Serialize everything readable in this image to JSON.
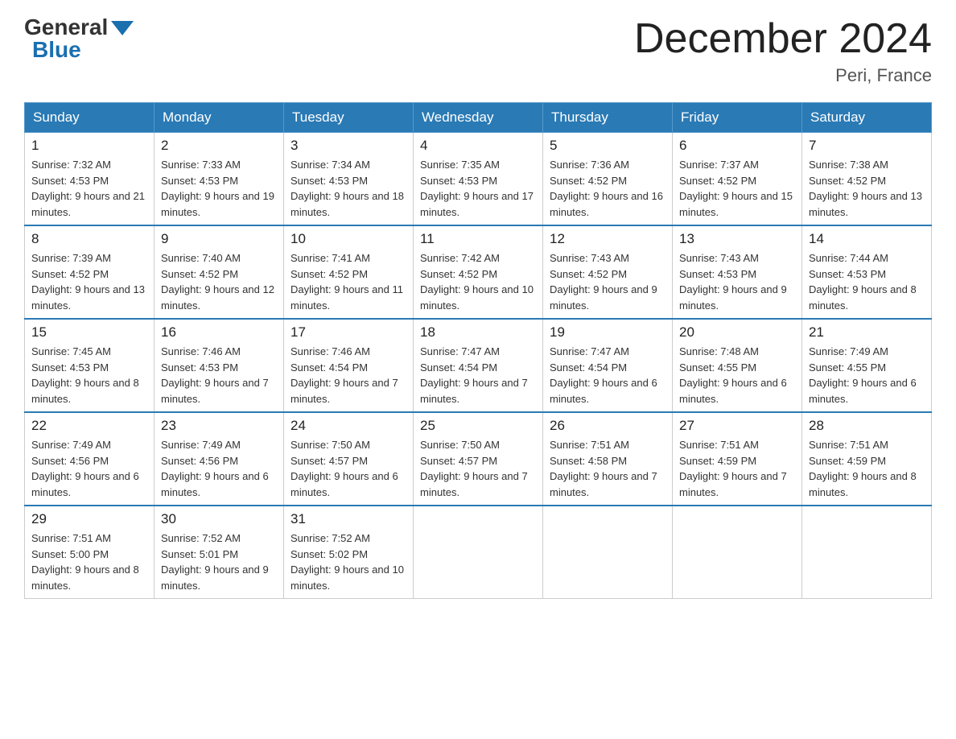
{
  "header": {
    "logo_general": "General",
    "logo_blue": "Blue",
    "main_title": "December 2024",
    "subtitle": "Peri, France"
  },
  "days_of_week": [
    "Sunday",
    "Monday",
    "Tuesday",
    "Wednesday",
    "Thursday",
    "Friday",
    "Saturday"
  ],
  "weeks": [
    [
      {
        "day": "1",
        "sunrise": "7:32 AM",
        "sunset": "4:53 PM",
        "daylight": "9 hours and 21 minutes."
      },
      {
        "day": "2",
        "sunrise": "7:33 AM",
        "sunset": "4:53 PM",
        "daylight": "9 hours and 19 minutes."
      },
      {
        "day": "3",
        "sunrise": "7:34 AM",
        "sunset": "4:53 PM",
        "daylight": "9 hours and 18 minutes."
      },
      {
        "day": "4",
        "sunrise": "7:35 AM",
        "sunset": "4:53 PM",
        "daylight": "9 hours and 17 minutes."
      },
      {
        "day": "5",
        "sunrise": "7:36 AM",
        "sunset": "4:52 PM",
        "daylight": "9 hours and 16 minutes."
      },
      {
        "day": "6",
        "sunrise": "7:37 AM",
        "sunset": "4:52 PM",
        "daylight": "9 hours and 15 minutes."
      },
      {
        "day": "7",
        "sunrise": "7:38 AM",
        "sunset": "4:52 PM",
        "daylight": "9 hours and 13 minutes."
      }
    ],
    [
      {
        "day": "8",
        "sunrise": "7:39 AM",
        "sunset": "4:52 PM",
        "daylight": "9 hours and 13 minutes."
      },
      {
        "day": "9",
        "sunrise": "7:40 AM",
        "sunset": "4:52 PM",
        "daylight": "9 hours and 12 minutes."
      },
      {
        "day": "10",
        "sunrise": "7:41 AM",
        "sunset": "4:52 PM",
        "daylight": "9 hours and 11 minutes."
      },
      {
        "day": "11",
        "sunrise": "7:42 AM",
        "sunset": "4:52 PM",
        "daylight": "9 hours and 10 minutes."
      },
      {
        "day": "12",
        "sunrise": "7:43 AM",
        "sunset": "4:52 PM",
        "daylight": "9 hours and 9 minutes."
      },
      {
        "day": "13",
        "sunrise": "7:43 AM",
        "sunset": "4:53 PM",
        "daylight": "9 hours and 9 minutes."
      },
      {
        "day": "14",
        "sunrise": "7:44 AM",
        "sunset": "4:53 PM",
        "daylight": "9 hours and 8 minutes."
      }
    ],
    [
      {
        "day": "15",
        "sunrise": "7:45 AM",
        "sunset": "4:53 PM",
        "daylight": "9 hours and 8 minutes."
      },
      {
        "day": "16",
        "sunrise": "7:46 AM",
        "sunset": "4:53 PM",
        "daylight": "9 hours and 7 minutes."
      },
      {
        "day": "17",
        "sunrise": "7:46 AM",
        "sunset": "4:54 PM",
        "daylight": "9 hours and 7 minutes."
      },
      {
        "day": "18",
        "sunrise": "7:47 AM",
        "sunset": "4:54 PM",
        "daylight": "9 hours and 7 minutes."
      },
      {
        "day": "19",
        "sunrise": "7:47 AM",
        "sunset": "4:54 PM",
        "daylight": "9 hours and 6 minutes."
      },
      {
        "day": "20",
        "sunrise": "7:48 AM",
        "sunset": "4:55 PM",
        "daylight": "9 hours and 6 minutes."
      },
      {
        "day": "21",
        "sunrise": "7:49 AM",
        "sunset": "4:55 PM",
        "daylight": "9 hours and 6 minutes."
      }
    ],
    [
      {
        "day": "22",
        "sunrise": "7:49 AM",
        "sunset": "4:56 PM",
        "daylight": "9 hours and 6 minutes."
      },
      {
        "day": "23",
        "sunrise": "7:49 AM",
        "sunset": "4:56 PM",
        "daylight": "9 hours and 6 minutes."
      },
      {
        "day": "24",
        "sunrise": "7:50 AM",
        "sunset": "4:57 PM",
        "daylight": "9 hours and 6 minutes."
      },
      {
        "day": "25",
        "sunrise": "7:50 AM",
        "sunset": "4:57 PM",
        "daylight": "9 hours and 7 minutes."
      },
      {
        "day": "26",
        "sunrise": "7:51 AM",
        "sunset": "4:58 PM",
        "daylight": "9 hours and 7 minutes."
      },
      {
        "day": "27",
        "sunrise": "7:51 AM",
        "sunset": "4:59 PM",
        "daylight": "9 hours and 7 minutes."
      },
      {
        "day": "28",
        "sunrise": "7:51 AM",
        "sunset": "4:59 PM",
        "daylight": "9 hours and 8 minutes."
      }
    ],
    [
      {
        "day": "29",
        "sunrise": "7:51 AM",
        "sunset": "5:00 PM",
        "daylight": "9 hours and 8 minutes."
      },
      {
        "day": "30",
        "sunrise": "7:52 AM",
        "sunset": "5:01 PM",
        "daylight": "9 hours and 9 minutes."
      },
      {
        "day": "31",
        "sunrise": "7:52 AM",
        "sunset": "5:02 PM",
        "daylight": "9 hours and 10 minutes."
      },
      null,
      null,
      null,
      null
    ]
  ],
  "labels": {
    "sunrise": "Sunrise:",
    "sunset": "Sunset:",
    "daylight": "Daylight:"
  }
}
